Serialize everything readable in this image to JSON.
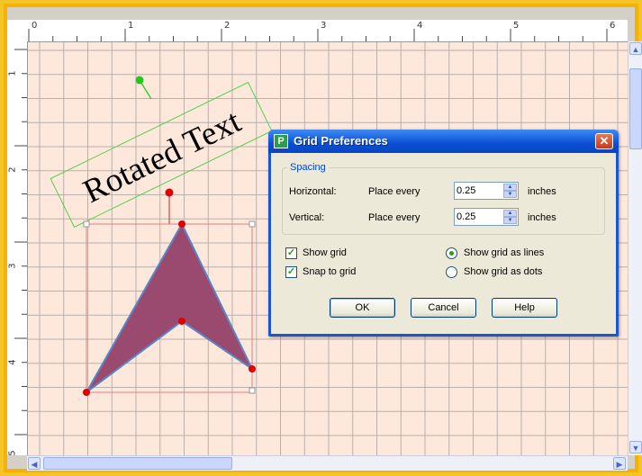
{
  "rulers": {
    "horizontal_labels": [
      "0",
      "1",
      "2",
      "3",
      "4",
      "5",
      "6"
    ],
    "vertical_labels": [
      "1",
      "2",
      "3",
      "4",
      "5"
    ]
  },
  "canvas": {
    "rotated_text": "Rotated Text",
    "grid_color": "#b7b0ad",
    "background_color": "#fee8dc",
    "shape_fill": "#9b4a6f",
    "shape_stroke": "#5b86c6",
    "handle_color": "#e00000",
    "rotate_handle_color": "#22c81e"
  },
  "dialog": {
    "title": "Grid Preferences",
    "icon_letter": "P",
    "close_glyph": "✕",
    "spacing": {
      "group_label": "Spacing",
      "horizontal": {
        "label": "Horizontal:",
        "place_label": "Place every",
        "value": "0.25",
        "unit": "inches"
      },
      "vertical": {
        "label": "Vertical:",
        "place_label": "Place every",
        "value": "0.25",
        "unit": "inches"
      }
    },
    "options": {
      "show_grid": {
        "label": "Show grid",
        "checked": true
      },
      "snap_to_grid": {
        "label": "Snap to grid",
        "checked": true
      },
      "grid_as_lines": {
        "label": "Show grid as lines",
        "selected": true
      },
      "grid_as_dots": {
        "label": "Show grid as dots",
        "selected": false
      }
    },
    "buttons": {
      "ok": "OK",
      "cancel": "Cancel",
      "help": "Help"
    }
  },
  "scrollbars": {
    "up_glyph": "▲",
    "down_glyph": "▼",
    "left_glyph": "◀",
    "right_glyph": "▶"
  }
}
